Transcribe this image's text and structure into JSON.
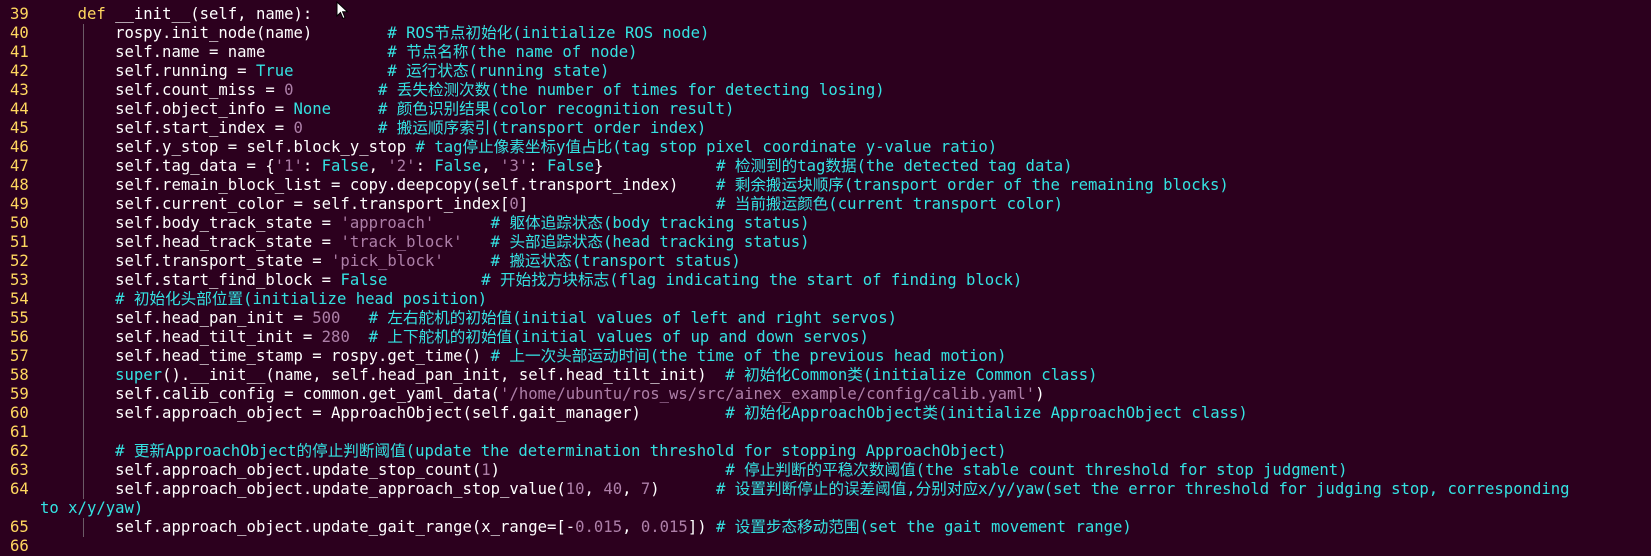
{
  "colors": {
    "background": "#2c001e",
    "line_number": "#ffd75f",
    "keyword": "#ffd75f",
    "comment": "#34e2e2",
    "boolean": "#34e2e2",
    "string": "#ad7fa8",
    "number": "#ad7fa8",
    "text": "#ffffff"
  },
  "lines": [
    {
      "n": "39",
      "segs": [
        [
          "def",
          "def"
        ],
        [
          "norm",
          " __init__(self, name):"
        ]
      ]
    },
    {
      "n": "40",
      "guide": true,
      "segs": [
        [
          "norm",
          "    rospy.init_node(name)        "
        ],
        [
          "cmt",
          "# ROS节点初始化(initialize ROS node)"
        ]
      ]
    },
    {
      "n": "41",
      "guide": true,
      "segs": [
        [
          "norm",
          "    self.name = name             "
        ],
        [
          "cmt",
          "# 节点名称(the name of node)"
        ]
      ]
    },
    {
      "n": "42",
      "guide": true,
      "segs": [
        [
          "norm",
          "    self.running = "
        ],
        [
          "bool",
          "True"
        ],
        [
          "norm",
          "          "
        ],
        [
          "cmt",
          "# 运行状态(running state)"
        ]
      ]
    },
    {
      "n": "43",
      "guide": true,
      "segs": [
        [
          "norm",
          "    self.count_miss = "
        ],
        [
          "num",
          "0"
        ],
        [
          "norm",
          "         "
        ],
        [
          "cmt",
          "# 丢失检测次数(the number of times for detecting losing)"
        ]
      ]
    },
    {
      "n": "44",
      "guide": true,
      "segs": [
        [
          "norm",
          "    self.object_info = "
        ],
        [
          "bool",
          "None"
        ],
        [
          "norm",
          "     "
        ],
        [
          "cmt",
          "# 颜色识别结果(color recognition result)"
        ]
      ]
    },
    {
      "n": "45",
      "guide": true,
      "segs": [
        [
          "norm",
          "    self.start_index = "
        ],
        [
          "num",
          "0"
        ],
        [
          "norm",
          "        "
        ],
        [
          "cmt",
          "# 搬运顺序索引(transport order index)"
        ]
      ]
    },
    {
      "n": "46",
      "guide": true,
      "segs": [
        [
          "norm",
          "    self.y_stop = self.block_y_stop "
        ],
        [
          "cmt",
          "# tag停止像素坐标y值占比(tag stop pixel coordinate y-value ratio)"
        ]
      ]
    },
    {
      "n": "47",
      "guide": true,
      "segs": [
        [
          "norm",
          "    self.tag_data = {"
        ],
        [
          "str",
          "'1'"
        ],
        [
          "norm",
          ": "
        ],
        [
          "bool",
          "False"
        ],
        [
          "norm",
          ", "
        ],
        [
          "str",
          "'2'"
        ],
        [
          "norm",
          ": "
        ],
        [
          "bool",
          "False"
        ],
        [
          "norm",
          ", "
        ],
        [
          "str",
          "'3'"
        ],
        [
          "norm",
          ": "
        ],
        [
          "bool",
          "False"
        ],
        [
          "norm",
          "}            "
        ],
        [
          "cmt",
          "# 检测到的tag数据(the detected tag data)"
        ]
      ]
    },
    {
      "n": "48",
      "guide": true,
      "segs": [
        [
          "norm",
          "    self.remain_block_list = copy.deepcopy(self.transport_index)    "
        ],
        [
          "cmt",
          "# 剩余搬运块顺序(transport order of the remaining blocks)"
        ]
      ]
    },
    {
      "n": "49",
      "guide": true,
      "segs": [
        [
          "norm",
          "    self.current_color = self.transport_index["
        ],
        [
          "num",
          "0"
        ],
        [
          "norm",
          "]                    "
        ],
        [
          "cmt",
          "# 当前搬运颜色(current transport color)"
        ]
      ]
    },
    {
      "n": "50",
      "guide": true,
      "segs": [
        [
          "norm",
          "    self.body_track_state = "
        ],
        [
          "str",
          "'approach'"
        ],
        [
          "norm",
          "      "
        ],
        [
          "cmt",
          "# 躯体追踪状态(body tracking status)"
        ]
      ]
    },
    {
      "n": "51",
      "guide": true,
      "segs": [
        [
          "norm",
          "    self.head_track_state = "
        ],
        [
          "str",
          "'track_block'"
        ],
        [
          "norm",
          "   "
        ],
        [
          "cmt",
          "# 头部追踪状态(head tracking status)"
        ]
      ]
    },
    {
      "n": "52",
      "guide": true,
      "segs": [
        [
          "norm",
          "    self.transport_state = "
        ],
        [
          "str",
          "'pick_block'"
        ],
        [
          "norm",
          "     "
        ],
        [
          "cmt",
          "# 搬运状态(transport status)"
        ]
      ]
    },
    {
      "n": "53",
      "guide": true,
      "segs": [
        [
          "norm",
          "    self.start_find_block = "
        ],
        [
          "bool",
          "False"
        ],
        [
          "norm",
          "          "
        ],
        [
          "cmt",
          "# 开始找方块标志(flag indicating the start of finding block)"
        ]
      ]
    },
    {
      "n": "54",
      "guide": true,
      "segs": [
        [
          "norm",
          "    "
        ],
        [
          "cmt",
          "# 初始化头部位置(initialize head position)"
        ]
      ]
    },
    {
      "n": "55",
      "guide": true,
      "segs": [
        [
          "norm",
          "    self.head_pan_init = "
        ],
        [
          "num",
          "500"
        ],
        [
          "norm",
          "   "
        ],
        [
          "cmt",
          "# 左右舵机的初始值(initial values of left and right servos)"
        ]
      ]
    },
    {
      "n": "56",
      "guide": true,
      "segs": [
        [
          "norm",
          "    self.head_tilt_init = "
        ],
        [
          "num",
          "280"
        ],
        [
          "norm",
          "  "
        ],
        [
          "cmt",
          "# 上下舵机的初始值(initial values of up and down servos)"
        ]
      ]
    },
    {
      "n": "57",
      "guide": true,
      "segs": [
        [
          "norm",
          "    self.head_time_stamp = rospy.get_time() "
        ],
        [
          "cmt",
          "# 上一次头部运动时间(the time of the previous head motion)"
        ]
      ]
    },
    {
      "n": "58",
      "guide": true,
      "segs": [
        [
          "norm",
          "    "
        ],
        [
          "bool",
          "super"
        ],
        [
          "norm",
          "().__init__(name, self.head_pan_init, self.head_tilt_init)  "
        ],
        [
          "cmt",
          "# 初始化Common类(initialize Common class)"
        ]
      ]
    },
    {
      "n": "59",
      "guide": true,
      "segs": [
        [
          "norm",
          "    self.calib_config = common.get_yaml_data("
        ],
        [
          "str",
          "'/home/ubuntu/ros_ws/src/ainex_example/config/calib.yaml'"
        ],
        [
          "norm",
          ")"
        ]
      ]
    },
    {
      "n": "60",
      "guide": true,
      "segs": [
        [
          "norm",
          "    self.approach_object = ApproachObject(self.gait_manager)         "
        ],
        [
          "cmt",
          "# 初始化ApproachObject类(initialize ApproachObject class)"
        ]
      ]
    },
    {
      "n": "61",
      "guide": true,
      "segs": [
        [
          "norm",
          ""
        ]
      ]
    },
    {
      "n": "62",
      "guide": true,
      "segs": [
        [
          "norm",
          "    "
        ],
        [
          "cmt",
          "# 更新ApproachObject的停止判断阈值(update the determination threshold for stopping ApproachObject)"
        ]
      ]
    },
    {
      "n": "63",
      "guide": true,
      "segs": [
        [
          "norm",
          "    self.approach_object.update_stop_count("
        ],
        [
          "num",
          "1"
        ],
        [
          "norm",
          ")                        "
        ],
        [
          "cmt",
          "# 停止判断的平稳次数阈值(the stable count threshold for stop judgment)"
        ]
      ]
    },
    {
      "n": "64",
      "guide": true,
      "segs": [
        [
          "norm",
          "    self.approach_object.update_approach_stop_value("
        ],
        [
          "num",
          "10"
        ],
        [
          "norm",
          ", "
        ],
        [
          "num",
          "40"
        ],
        [
          "norm",
          ", "
        ],
        [
          "num",
          "7"
        ],
        [
          "norm",
          ")      "
        ],
        [
          "cmt",
          "# 设置判断停止的误差阈值,分别对应x/y/yaw(set the error threshold for judging stop, corresponding"
        ]
      ]
    },
    {
      "n": "",
      "wrap": true,
      "segs": [
        [
          "cmt",
          "to x/y/yaw)"
        ]
      ]
    },
    {
      "n": "65",
      "guide": true,
      "segs": [
        [
          "norm",
          "    self.approach_object.update_gait_range(x_range=[-"
        ],
        [
          "num",
          "0.015"
        ],
        [
          "norm",
          ", "
        ],
        [
          "num",
          "0.015"
        ],
        [
          "norm",
          "]) "
        ],
        [
          "cmt",
          "# 设置步态移动范围(set the gait movement range)"
        ]
      ]
    },
    {
      "n": "66",
      "guide": false,
      "segs": [
        [
          "norm",
          ""
        ]
      ]
    }
  ]
}
